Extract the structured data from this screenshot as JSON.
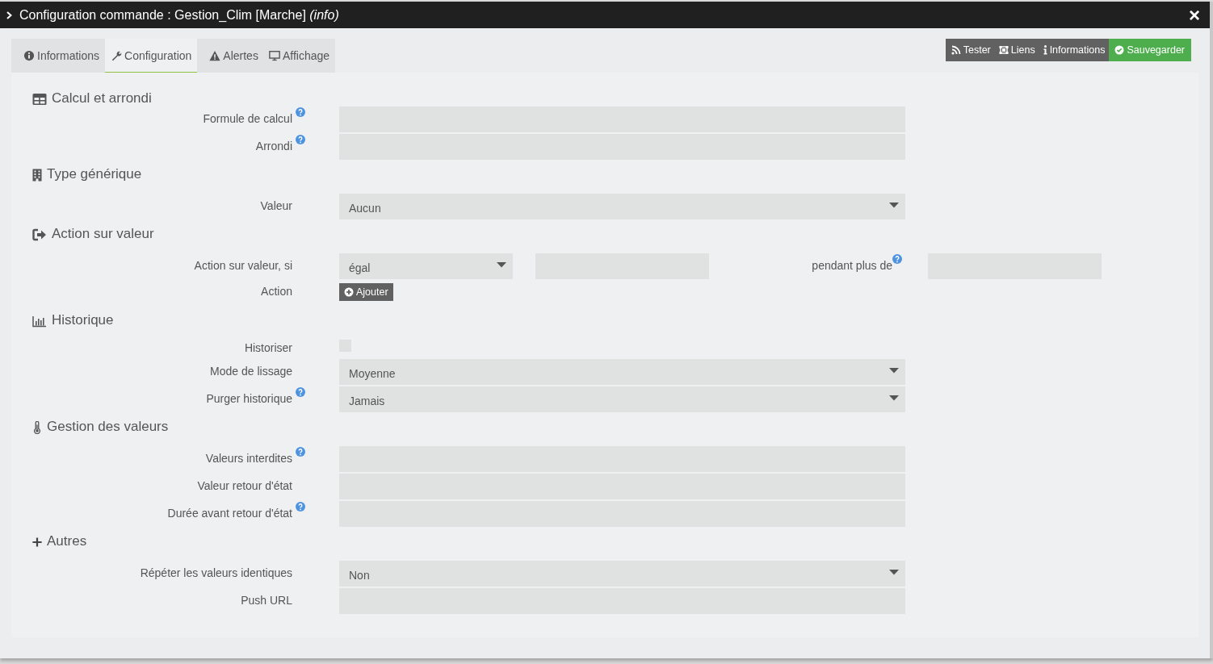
{
  "window": {
    "title": "Configuration commande : Gestion_Clim [Marche] *(info)*",
    "close": "×"
  },
  "tabs": [
    {
      "label": "Informations",
      "selected": false
    },
    {
      "label": "Configuration",
      "selected": true
    },
    {
      "label": "Alertes",
      "selected": false
    },
    {
      "label": "Affichage",
      "selected": false
    }
  ],
  "actions": [
    {
      "label": "Tester",
      "kind": "default"
    },
    {
      "label": "Liens",
      "kind": "default"
    },
    {
      "label": "Informations",
      "kind": "default"
    },
    {
      "label": "Sauvegarder",
      "kind": "success"
    }
  ],
  "sections": [
    {
      "title": "Calcul et arrondi",
      "rows": [
        {
          "label": "Formule de calcul",
          "help": true,
          "kind": "text"
        },
        {
          "label": "Arrondi",
          "help": true,
          "kind": "text"
        }
      ]
    },
    {
      "title": "Type générique",
      "rows": [
        {
          "label": "Valeur",
          "help": false,
          "kind": "select",
          "value": "Aucun"
        }
      ]
    },
    {
      "title": "Action sur valeur",
      "rows": [
        {
          "label": "Action sur valeur, si",
          "help": false,
          "kind": "condition",
          "value": "égal",
          "sublabel": "pendant plus de",
          "subhelp": true
        },
        {
          "label": "Action",
          "help": false,
          "kind": "button",
          "value": "Ajouter"
        }
      ]
    },
    {
      "title": "Historique",
      "rows": [
        {
          "label": "Historiser",
          "help": false,
          "kind": "checkbox",
          "checked": false
        },
        {
          "label": "Mode de lissage",
          "help": false,
          "kind": "select",
          "value": "Moyenne"
        },
        {
          "label": "Purger historique",
          "help": true,
          "kind": "select",
          "value": "Jamais"
        }
      ]
    },
    {
      "title": "Gestion des valeurs",
      "rows": [
        {
          "label": "Valeurs interdites",
          "help": true,
          "kind": "text"
        },
        {
          "label": "Valeur retour d'état",
          "help": false,
          "kind": "text"
        },
        {
          "label": "Durée avant retour d'état",
          "help": true,
          "kind": "text"
        }
      ]
    },
    {
      "title": "Autres",
      "rows": [
        {
          "label": "Répéter les valeurs identiques",
          "help": false,
          "kind": "select",
          "value": "Non"
        },
        {
          "label": "Push URL",
          "help": false,
          "kind": "text"
        }
      ]
    }
  ]
}
